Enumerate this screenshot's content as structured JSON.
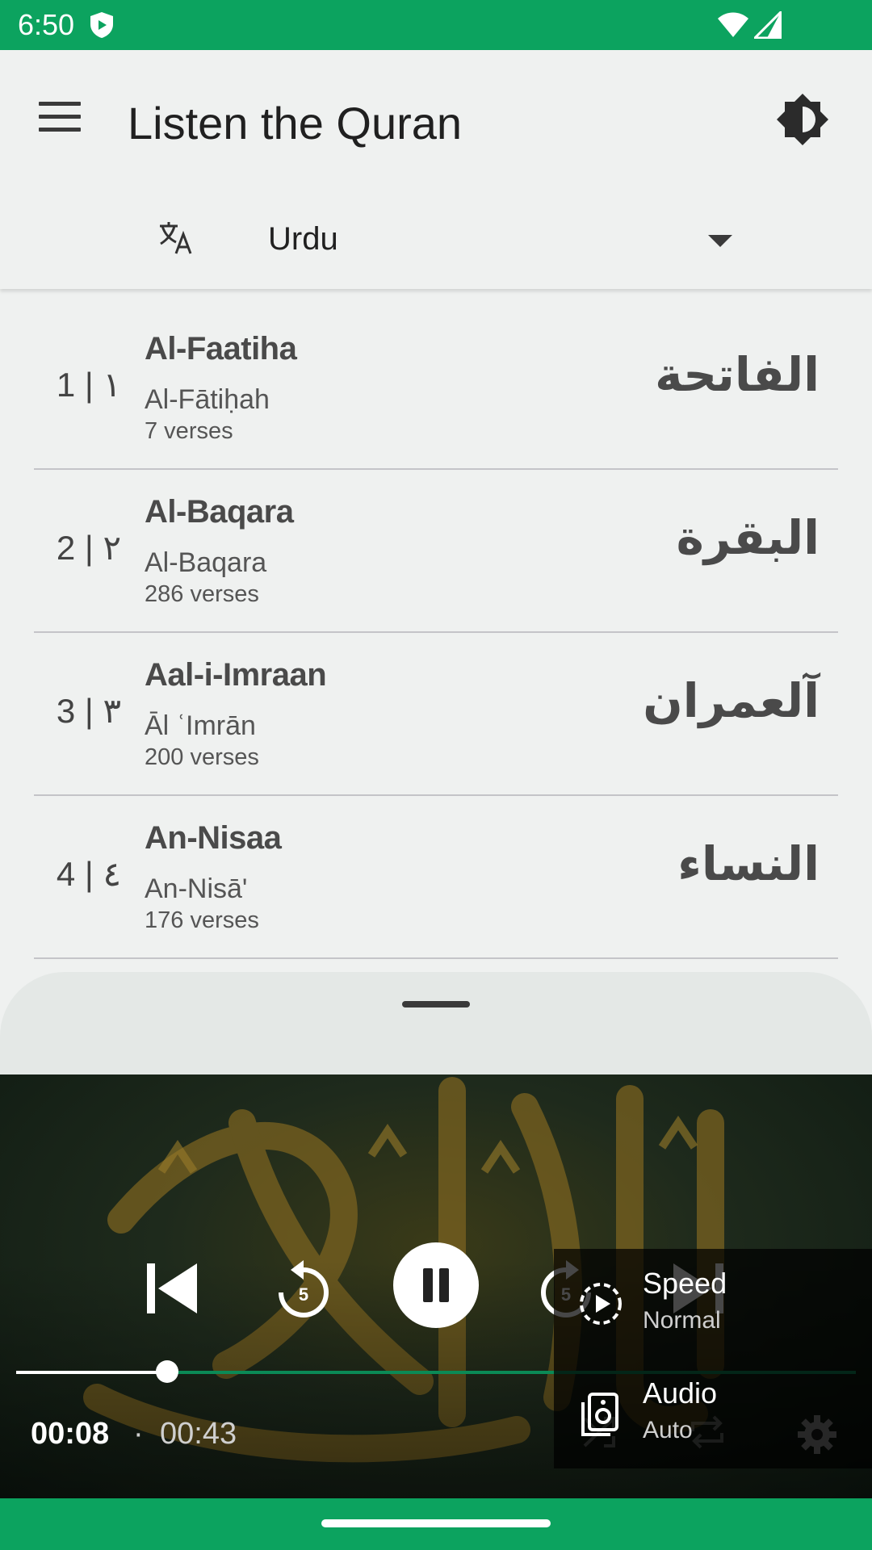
{
  "status_bar": {
    "time": "6:50"
  },
  "app_bar": {
    "title": "Listen the Quran"
  },
  "language_selector": {
    "selected": "Urdu"
  },
  "surahs": [
    {
      "number": "1 | ١",
      "name": "Al-Faatiha",
      "transliteration": "Al-Fātiḥah",
      "verses": "7 verses",
      "arabic": "الفاتحة"
    },
    {
      "number": "2 | ٢",
      "name": "Al-Baqara",
      "transliteration": "Al-Baqara",
      "verses": "286 verses",
      "arabic": "البقرة"
    },
    {
      "number": "3 | ٣",
      "name": "Aal-i-Imraan",
      "transliteration": "Āl ʿImrān",
      "verses": "200 verses",
      "arabic": "آلعمران"
    },
    {
      "number": "4 | ٤",
      "name": "An-Nisaa",
      "transliteration": "An-Nisā'",
      "verses": "176 verses",
      "arabic": "النساء"
    }
  ],
  "player": {
    "current_time": "00:08",
    "separator": "·",
    "total_time": "00:43",
    "rewind_seconds": "5",
    "forward_seconds": "5",
    "progress": 0.18
  },
  "settings_menu": {
    "speed_label": "Speed",
    "speed_value": "Normal",
    "audio_label": "Audio",
    "audio_value": "Auto"
  },
  "colors": {
    "accent": "#0ca35f",
    "progress": "#0b8a56"
  }
}
